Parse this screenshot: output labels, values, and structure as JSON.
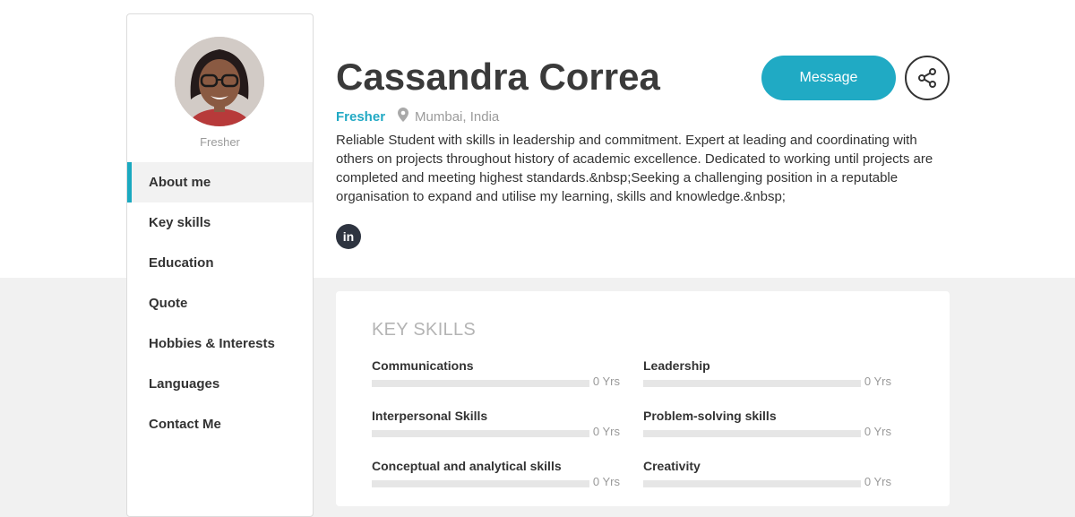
{
  "profile": {
    "name": "Cassandra Correa",
    "status": "Fresher",
    "location": "Mumbai, India",
    "bio": "Reliable Student with skills in leadership and commitment. Expert at leading and coordinating with others on projects throughout history of academic excellence. Dedicated to working until projects are completed and meeting highest standards.&nbsp;Seeking a challenging position in a reputable organisation to expand and utilise my learning, skills and knowledge.&nbsp;",
    "linkedin_label": "in"
  },
  "sidebar": {
    "status": "Fresher",
    "items": [
      {
        "label": "About me"
      },
      {
        "label": "Key skills"
      },
      {
        "label": "Education"
      },
      {
        "label": "Quote"
      },
      {
        "label": "Hobbies & Interests"
      },
      {
        "label": "Languages"
      },
      {
        "label": "Contact Me"
      }
    ]
  },
  "actions": {
    "message_label": "Message"
  },
  "key_skills": {
    "title": "KEY SKILLS",
    "items": [
      {
        "name": "Communications",
        "years": "0 Yrs",
        "level": 0
      },
      {
        "name": "Leadership",
        "years": "0 Yrs",
        "level": 0
      },
      {
        "name": "Interpersonal Skills",
        "years": "0 Yrs",
        "level": 0
      },
      {
        "name": "Problem-solving skills",
        "years": "0 Yrs",
        "level": 0
      },
      {
        "name": "Conceptual and analytical skills",
        "years": "0 Yrs",
        "level": 0
      },
      {
        "name": "Creativity",
        "years": "0 Yrs",
        "level": 0
      }
    ]
  },
  "colors": {
    "accent": "#20aac4",
    "dark": "#2e3440",
    "muted": "#9b9b9b"
  }
}
